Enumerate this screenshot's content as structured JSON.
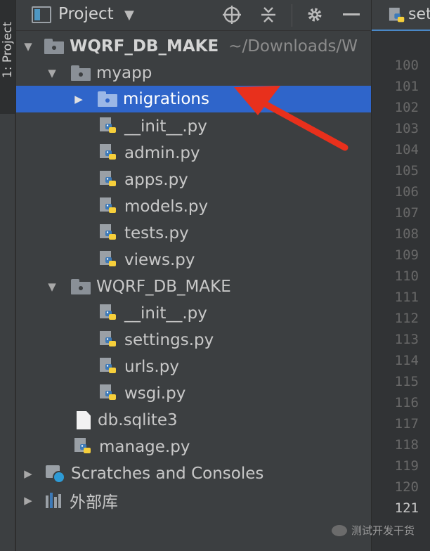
{
  "sidebar_strip": {
    "label": "1: Project"
  },
  "toolbar": {
    "title": "Project"
  },
  "editor_tab": {
    "label": "set"
  },
  "tree": [
    {
      "label": "WQRF_DB_MAKE",
      "path": "~/Downloads/W",
      "type": "root-folder",
      "expanded": true
    },
    {
      "label": "myapp",
      "type": "folder",
      "expanded": true
    },
    {
      "label": "migrations",
      "type": "folder",
      "expanded": false,
      "selected": true
    },
    {
      "label": "__init__.py",
      "type": "python"
    },
    {
      "label": "admin.py",
      "type": "python"
    },
    {
      "label": "apps.py",
      "type": "python"
    },
    {
      "label": "models.py",
      "type": "python"
    },
    {
      "label": "tests.py",
      "type": "python"
    },
    {
      "label": "views.py",
      "type": "python"
    },
    {
      "label": "WQRF_DB_MAKE",
      "type": "folder",
      "expanded": true
    },
    {
      "label": "__init__.py",
      "type": "python"
    },
    {
      "label": "settings.py",
      "type": "python"
    },
    {
      "label": "urls.py",
      "type": "python"
    },
    {
      "label": "wsgi.py",
      "type": "python"
    },
    {
      "label": "db.sqlite3",
      "type": "file"
    },
    {
      "label": "manage.py",
      "type": "python"
    },
    {
      "label": "Scratches and Consoles",
      "type": "scratches",
      "expanded": false
    },
    {
      "label": "外部库",
      "type": "library",
      "expanded": false
    }
  ],
  "gutter": {
    "lines": [
      "100",
      "101",
      "102",
      "103",
      "104",
      "105",
      "106",
      "107",
      "108",
      "109",
      "110",
      "111",
      "112",
      "113",
      "114",
      "115",
      "116",
      "117",
      "118",
      "119",
      "120",
      "121"
    ],
    "current": "121"
  },
  "watermark": {
    "text": "测试开发干货"
  },
  "colors": {
    "selection": "#2f65ca",
    "panel": "#3c3f41",
    "gutter": "#313335",
    "annotation_arrow": "#e8301c",
    "python_blue": "#3d7ab8",
    "python_yellow": "#f6cf3b"
  },
  "icons": {
    "view_mode": "project-view-icon",
    "dropdown": "chevron-down-icon",
    "locate": "crosshair-icon",
    "collapse": "collapse-all-icon",
    "settings": "gear-icon",
    "hide": "minimize-icon"
  }
}
